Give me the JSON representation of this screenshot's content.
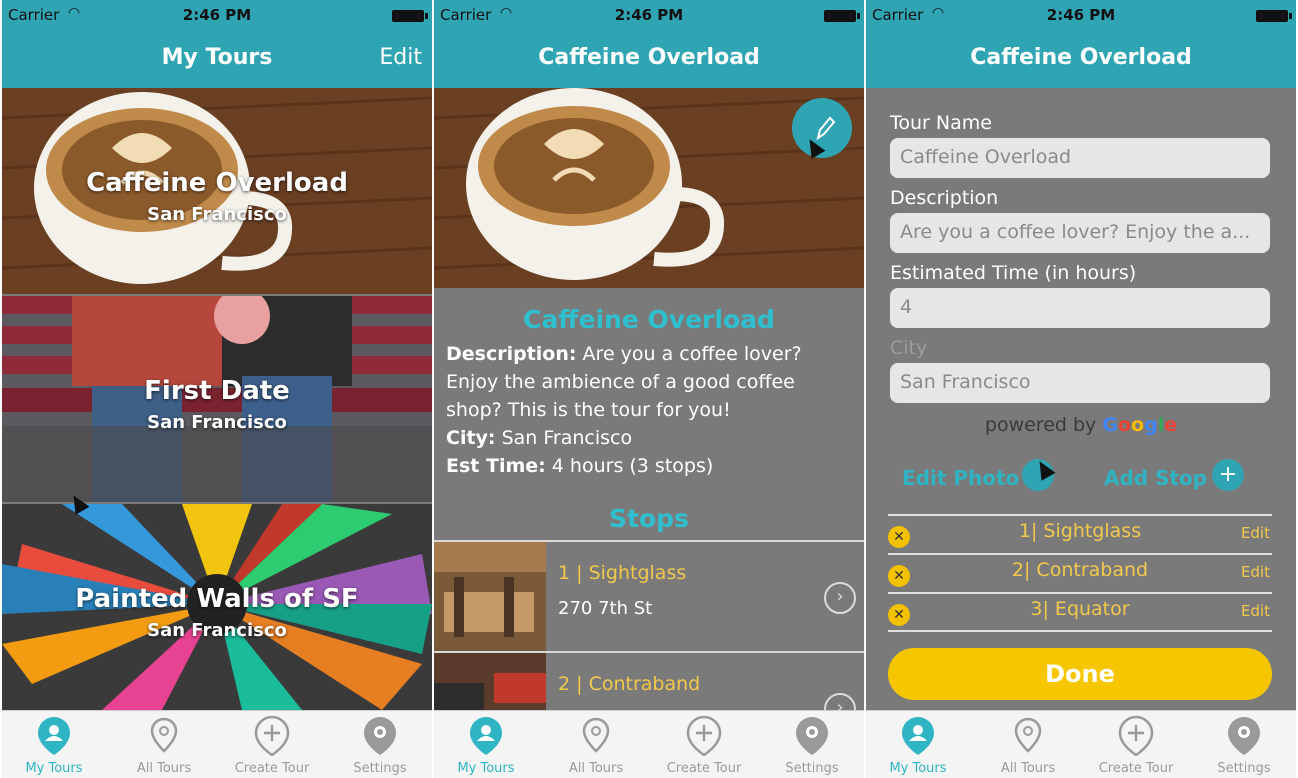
{
  "status": {
    "carrier": "Carrier",
    "time": "2:46 PM"
  },
  "screen1": {
    "nav_title": "My Tours",
    "nav_right": "Edit",
    "tours": [
      {
        "name": "Caffeine Overload",
        "city": "San Francisco"
      },
      {
        "name": "First Date",
        "city": "San Francisco"
      },
      {
        "name": "Painted Walls of SF",
        "city": "San Francisco"
      }
    ]
  },
  "screen2": {
    "nav_title": "Caffeine Overload",
    "title": "Caffeine Overload",
    "description_label": "Description:",
    "description": "Are you a coffee lover? Enjoy the ambience of a good coffee shop? This is the tour for you!",
    "city_label": "City:",
    "city": "San Francisco",
    "time_label": "Est Time:",
    "time": "4 hours (3 stops)",
    "stops_title": "Stops",
    "stops": [
      {
        "name": "1 | Sightglass",
        "address": "270 7th St"
      },
      {
        "name": "2 | Contraband",
        "address": ""
      }
    ]
  },
  "screen3": {
    "nav_title": "Caffeine Overload",
    "tour_name_label": "Tour Name",
    "tour_name_value": "Caffeine Overload",
    "description_label": "Description",
    "description_value": "Are you a coffee lover? Enjoy the a...",
    "time_label": "Estimated Time (in hours)",
    "time_value": "4",
    "city_label": "City",
    "city_value": "San Francisco",
    "powered_by": "powered by",
    "google": [
      "G",
      "o",
      "o",
      "g",
      "l",
      "e"
    ],
    "edit_photo": "Edit Photo",
    "add_stop": "Add Stop",
    "stops": [
      {
        "name": "1| Sightglass",
        "edit": "Edit"
      },
      {
        "name": "2| Contraband",
        "edit": "Edit"
      },
      {
        "name": "3| Equator",
        "edit": "Edit"
      }
    ],
    "done": "Done"
  },
  "tabs": [
    {
      "label": "My Tours",
      "icon": "user-pin-icon"
    },
    {
      "label": "All Tours",
      "icon": "map-pin-icon"
    },
    {
      "label": "Create Tour",
      "icon": "add-pin-icon"
    },
    {
      "label": "Settings",
      "icon": "gear-pin-icon"
    }
  ],
  "colors": {
    "teal": "#2fa4b2",
    "accent": "#2fc0d0",
    "yellow": "#f6c700",
    "gray": "#7a7a7a"
  }
}
